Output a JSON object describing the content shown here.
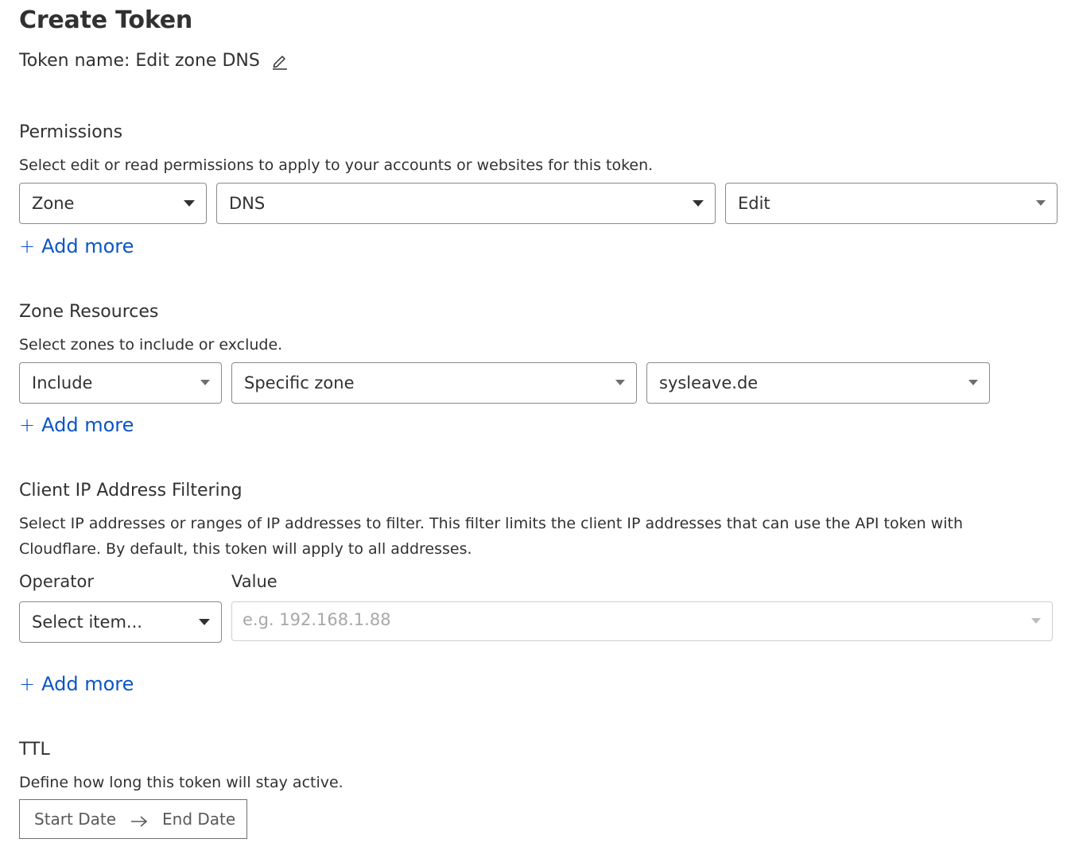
{
  "page": {
    "title": "Create Token",
    "token_name": "Token name: Edit zone DNS"
  },
  "permissions": {
    "title": "Permissions",
    "description": "Select edit or read permissions to apply to your accounts or websites for this token.",
    "selects": [
      "Zone",
      "DNS",
      "Edit"
    ],
    "add_more": "Add more"
  },
  "zone_resources": {
    "title": "Zone Resources",
    "description": "Select zones to include or exclude.",
    "selects": [
      "Include",
      "Specific zone",
      "sysleave.de"
    ],
    "add_more": "Add more"
  },
  "ip_filtering": {
    "title": "Client IP Address Filtering",
    "description_line1": "Select IP addresses or ranges of IP addresses to filter. This filter limits the client IP addresses that can use the API token with",
    "description_line2": "Cloudflare. By default, this token will apply to all addresses.",
    "operator_label": "Operator",
    "value_label": "Value",
    "operator_placeholder": "Select item...",
    "value_placeholder": "e.g. 192.168.1.88",
    "add_more": "Add more"
  },
  "ttl": {
    "title": "TTL",
    "description": "Define how long this token will stay active.",
    "start_date": "Start Date",
    "end_date": "End Date"
  },
  "icons": {
    "edit": "pencil-icon",
    "plus": "plus-icon",
    "caret": "caret-down-icon",
    "arrow": "arrow-right-icon"
  },
  "colors": {
    "link": "#0a55c7",
    "text": "#313131",
    "border": "#8a8a8a"
  }
}
